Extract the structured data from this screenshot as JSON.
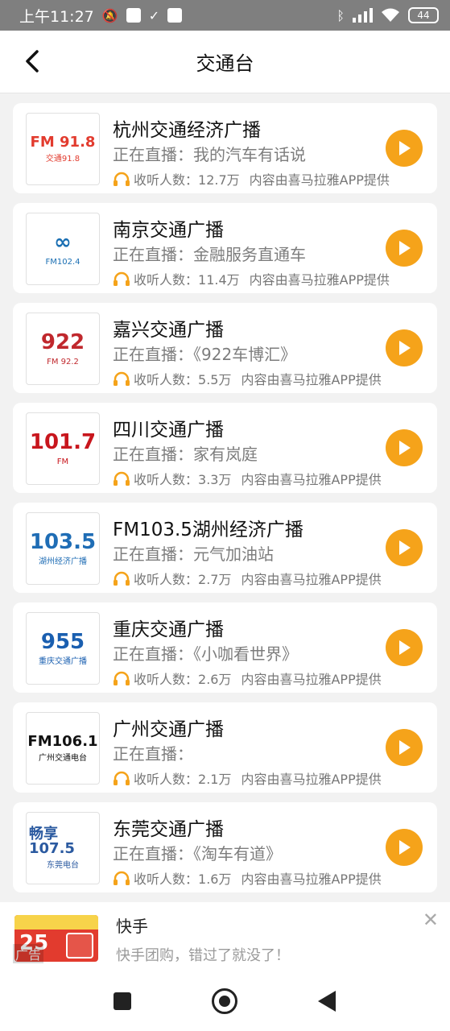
{
  "status_bar": {
    "time": "上午11:27",
    "battery": "44"
  },
  "header": {
    "title": "交通台"
  },
  "colors": {
    "accent": "#f5a31a",
    "background": "#f2f2f2"
  },
  "stations": [
    {
      "name": "杭州交通经济广播",
      "live_prefix": "正在直播：",
      "program": "我的汽车有话说",
      "listen_label": "收听人数：",
      "listeners": "12.7万",
      "provider": "内容由喜马拉雅APP提供",
      "logo_main": "FM 91.8",
      "logo_sub": "交通91.8",
      "logo_color": "#e23b2e"
    },
    {
      "name": "南京交通广播",
      "live_prefix": "正在直播：",
      "program": "金融服务直通车",
      "listen_label": "收听人数：",
      "listeners": "11.4万",
      "provider": "内容由喜马拉雅APP提供",
      "logo_main": "∞",
      "logo_sub": "FM102.4",
      "logo_color": "#1a6fb3"
    },
    {
      "name": "嘉兴交通广播",
      "live_prefix": "正在直播：",
      "program": "《922车博汇》",
      "listen_label": "收听人数：",
      "listeners": "5.5万",
      "provider": "内容由喜马拉雅APP提供",
      "logo_main": "922",
      "logo_sub": "FM 92.2",
      "logo_color": "#c0282d"
    },
    {
      "name": "四川交通广播",
      "live_prefix": "正在直播：",
      "program": "家有岚庭",
      "listen_label": "收听人数：",
      "listeners": "3.3万",
      "provider": "内容由喜马拉雅APP提供",
      "logo_main": "101.7",
      "logo_sub": "FM",
      "logo_color": "#c8161d"
    },
    {
      "name": "FM103.5湖州经济广播",
      "live_prefix": "正在直播：",
      "program": "元气加油站",
      "listen_label": "收听人数：",
      "listeners": "2.7万",
      "provider": "内容由喜马拉雅APP提供",
      "logo_main": "103.5",
      "logo_sub": "湖州经济广播",
      "logo_color": "#1f6db5"
    },
    {
      "name": "重庆交通广播",
      "live_prefix": "正在直播：",
      "program": "《小咖看世界》",
      "listen_label": "收听人数：",
      "listeners": "2.6万",
      "provider": "内容由喜马拉雅APP提供",
      "logo_main": "955",
      "logo_sub": "重庆交通广播",
      "logo_color": "#1a5fb0"
    },
    {
      "name": "广州交通广播",
      "live_prefix": "正在直播：",
      "program": "",
      "listen_label": "收听人数：",
      "listeners": "2.1万",
      "provider": "内容由喜马拉雅APP提供",
      "logo_main": "FM106.1",
      "logo_sub": "广州交通电台",
      "logo_color": "#111111"
    },
    {
      "name": "东莞交通广播",
      "live_prefix": "正在直播：",
      "program": "《淘车有道》",
      "listen_label": "收听人数：",
      "listeners": "1.6万",
      "provider": "内容由喜马拉雅APP提供",
      "logo_main": "畅享107.5",
      "logo_sub": "东莞电台",
      "logo_color": "#2b5aa0"
    }
  ],
  "ad": {
    "title": "快手",
    "description": "快手团购，错过了就没了！",
    "tag": "广告",
    "image_text": "25"
  }
}
